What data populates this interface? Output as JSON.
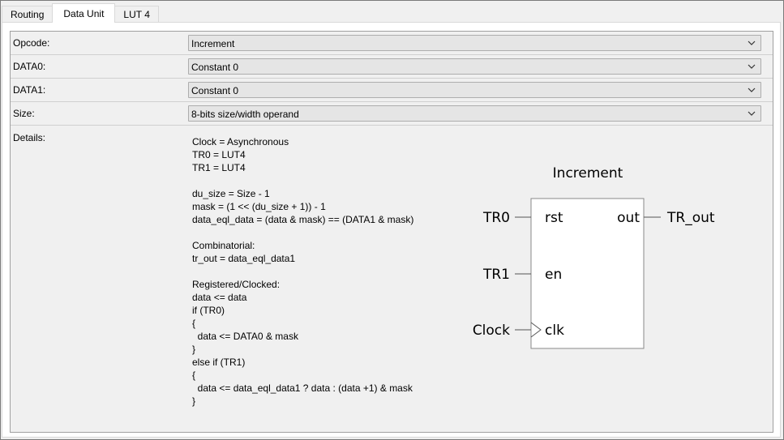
{
  "tabs": [
    {
      "label": "Routing",
      "active": false
    },
    {
      "label": "Data Unit",
      "active": true
    },
    {
      "label": "LUT 4",
      "active": false
    }
  ],
  "fields": [
    {
      "label": "Opcode:",
      "value": "Increment"
    },
    {
      "label": "DATA0:",
      "value": "Constant 0"
    },
    {
      "label": "DATA1:",
      "value": "Constant 0"
    },
    {
      "label": "Size:",
      "value": "8-bits size/width operand"
    }
  ],
  "details": {
    "label": "Details:",
    "lines": [
      "Clock = Asynchronous",
      "TR0 = LUT4",
      "TR1 = LUT4",
      "",
      "du_size = Size - 1",
      "mask = (1 << (du_size + 1)) - 1",
      "data_eql_data = (data & mask) == (DATA1 & mask)",
      "",
      "Combinatorial:",
      "tr_out = data_eql_data1",
      "",
      "Registered/Clocked:",
      "data <= data",
      "if (TR0)",
      "{",
      "  data <= DATA0 & mask",
      "}",
      "else if (TR1)",
      "{",
      "  data <= data_eql_data1 ? data : (data +1) & mask",
      "}"
    ]
  },
  "diagram": {
    "title": "Increment",
    "inputs": [
      "TR0",
      "TR1",
      "Clock"
    ],
    "ports_in": [
      "rst",
      "en",
      "clk"
    ],
    "port_out": "out",
    "output": "TR_out"
  },
  "icons": {
    "dropdown": "chevron-down-icon"
  }
}
